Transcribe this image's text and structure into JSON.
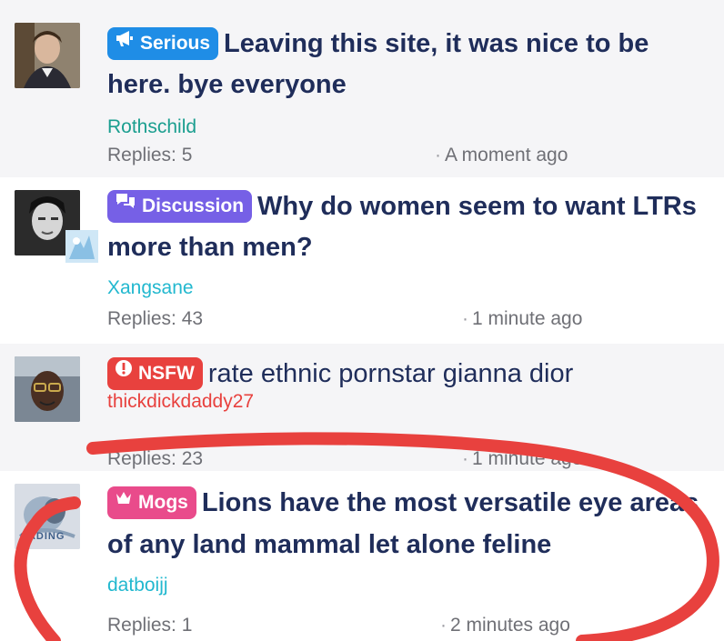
{
  "threads": [
    {
      "badge": "Serious",
      "badge_icon": "megaphone-icon",
      "badge_color": "#1f8de6",
      "title": "Leaving this site, it was nice to be here. bye everyone",
      "author": "Rothschild",
      "author_color": "#1a9e8f",
      "replies": "Replies: 5",
      "time": "A moment ago"
    },
    {
      "badge": "Discussion",
      "badge_icon": "chat-bubbles-icon",
      "badge_color": "#7660e6",
      "title": "Why do women seem to want LTRs more than men?",
      "author": "Xangsane",
      "author_color": "#22b8cf",
      "replies": "Replies: 43",
      "time": "1 minute ago"
    },
    {
      "badge": "NSFW",
      "badge_icon": "exclamation-circle-icon",
      "badge_color": "#e8413e",
      "title": "rate ethnic pornstar gianna dior",
      "author": "thickdickdaddy27",
      "author_color": "#e8413e",
      "replies": "Replies: 23",
      "time": "1 minute ago"
    },
    {
      "badge": "Mogs",
      "badge_icon": "crown-icon",
      "badge_color": "#e94b8b",
      "title": "Lions have the most versatile eye areas of any land mammal let alone feline",
      "author": "datboijj",
      "author_color": "#22b8cf",
      "replies": "Replies: 1",
      "time": "2 minutes ago"
    }
  ],
  "annotation_color": "#e8413e",
  "avatar_overlay_text": "CADING"
}
